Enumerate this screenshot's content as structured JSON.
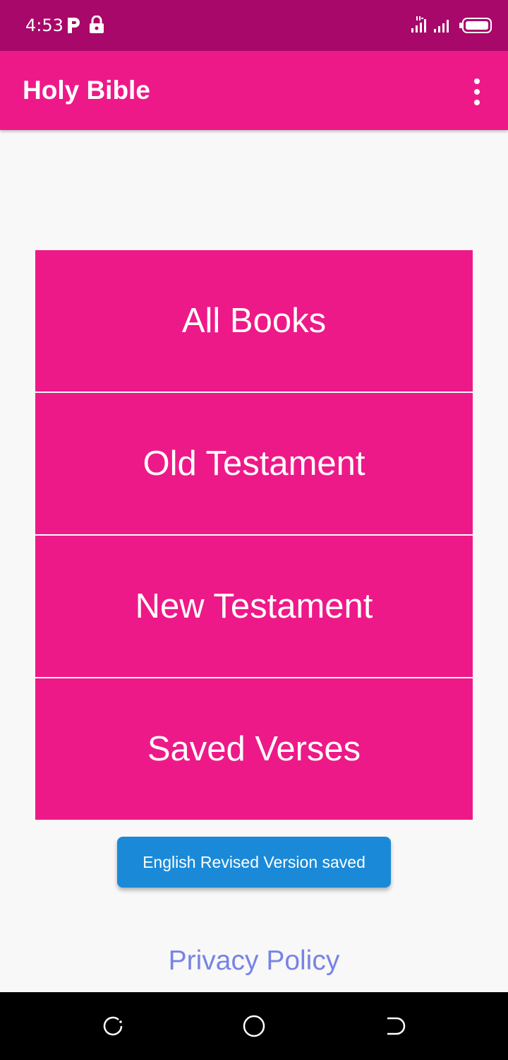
{
  "status_bar": {
    "time": "4:53",
    "icons": [
      "parking-icon",
      "lock-icon",
      "signal-4g-icon",
      "signal-icon",
      "battery-icon"
    ]
  },
  "app_bar": {
    "title": "Holy Bible",
    "menu_icon": "more-vert-icon"
  },
  "menu": {
    "items": [
      {
        "label": "All Books"
      },
      {
        "label": "Old Testament"
      },
      {
        "label": "New Testament"
      },
      {
        "label": "Saved Verses"
      }
    ]
  },
  "toast": {
    "message": "English Revised Version saved"
  },
  "footer": {
    "privacy_label": "Privacy Policy"
  },
  "nav_bar": {
    "icons": [
      "recents-icon",
      "home-icon",
      "back-icon"
    ]
  },
  "colors": {
    "status_bar": "#a80869",
    "primary": "#ee1988",
    "toast": "#1a8ad8",
    "link": "#7883e6",
    "background": "#f8f8f8"
  }
}
